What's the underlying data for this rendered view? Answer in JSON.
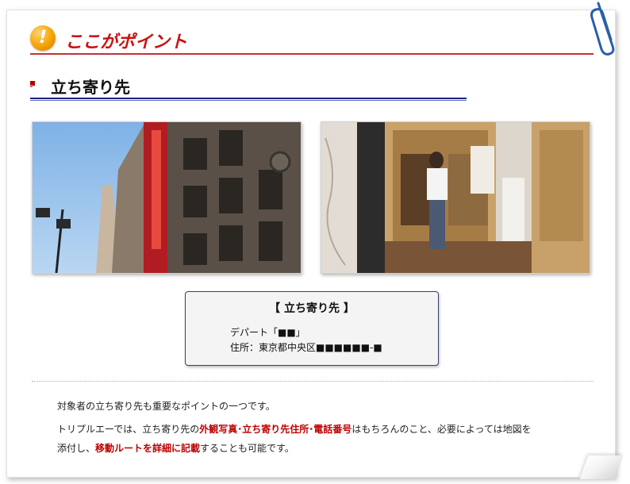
{
  "header": {
    "icon_char": "!",
    "title": "ここがポイント"
  },
  "section": {
    "title": "立ち寄り先"
  },
  "photos": {
    "left": "building-exterior-photo",
    "right": "store-entrance-photo"
  },
  "infobox": {
    "title": "【 立ち寄り先 】",
    "line1": "デパート「■■」",
    "line2": "住所：東京都中央区■■■■■■-■"
  },
  "body": {
    "p1": "対象者の立ち寄り先も重要なポイントの一つです。",
    "p2_a": "トリプルエーでは、立ち寄り先の",
    "p2_b": "外観写真･立ち寄り先住所･電話番号",
    "p2_c": "はもちろんのこと、必要によっては地図を",
    "p3_a": "添付し、",
    "p3_b": "移動ルートを詳細に記載",
    "p3_c": "することも可能です。"
  },
  "colors": {
    "accent_red": "#cc1111",
    "rule_navy": "#1a237e",
    "emphasis": "#c00000"
  }
}
